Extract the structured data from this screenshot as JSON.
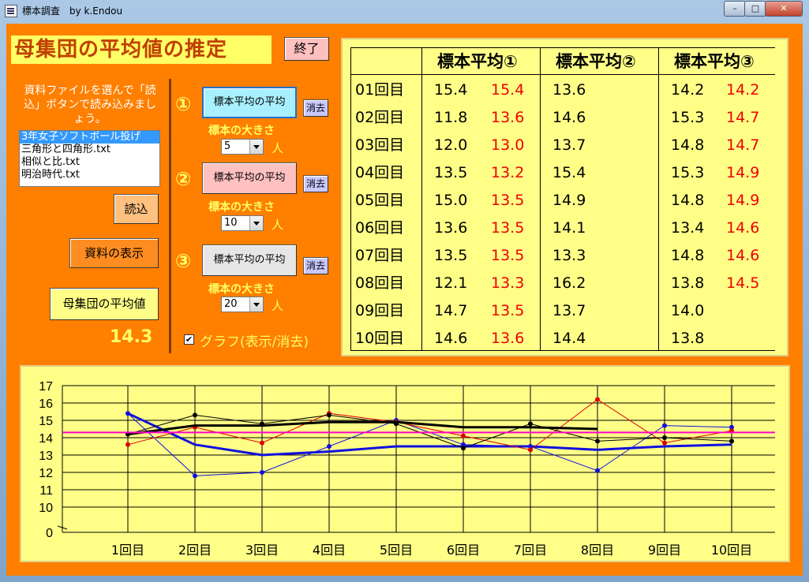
{
  "window": {
    "title": "標本調査　by k.Endou",
    "min": "–",
    "max": "□",
    "close": "✕"
  },
  "heading": "母集団の平均値の推定",
  "exit_button": "終了",
  "instructions": "資料ファイルを選んで「読込」ボタンで読み込みましょう。",
  "files": [
    "3年女子ソフトボール投げ",
    "三角形と四角形.txt",
    "相似と比.txt",
    "明治時代.txt"
  ],
  "load_button": "読込",
  "show_data_button": "資料の表示",
  "population_mean_button": "母集団の平均値",
  "population_mean_value": "14.3",
  "samplers": [
    {
      "number": "①",
      "button": "標本平均の平均",
      "clear": "消去",
      "size_label": "標本の大きさ",
      "size": "5",
      "unit": "人"
    },
    {
      "number": "②",
      "button": "標本平均の平均",
      "clear": "消去",
      "size_label": "標本の大きさ",
      "size": "10",
      "unit": "人"
    },
    {
      "number": "③",
      "button": "標本平均の平均",
      "clear": "消去",
      "size_label": "標本の大きさ",
      "size": "20",
      "unit": "人"
    }
  ],
  "graph_checkbox": {
    "mark": "✔",
    "label": "グラフ(表示/消去)"
  },
  "table": {
    "headers": [
      "標本平均①",
      "標本平均②",
      "標本平均③"
    ],
    "rows": [
      {
        "label": "01回目",
        "s1": "15.4",
        "r1": "15.4",
        "s2": "13.6",
        "s3": "14.2",
        "r3": "14.2"
      },
      {
        "label": "02回目",
        "s1": "11.8",
        "r1": "13.6",
        "s2": "14.6",
        "s3": "15.3",
        "r3": "14.7"
      },
      {
        "label": "03回目",
        "s1": "12.0",
        "r1": "13.0",
        "s2": "13.7",
        "s3": "14.8",
        "r3": "14.7"
      },
      {
        "label": "04回目",
        "s1": "13.5",
        "r1": "13.2",
        "s2": "15.4",
        "s3": "15.3",
        "r3": "14.9"
      },
      {
        "label": "05回目",
        "s1": "15.0",
        "r1": "13.5",
        "s2": "14.9",
        "s3": "14.8",
        "r3": "14.9"
      },
      {
        "label": "06回目",
        "s1": "13.6",
        "r1": "13.5",
        "s2": "14.1",
        "s3": "13.4",
        "r3": "14.6"
      },
      {
        "label": "07回目",
        "s1": "13.5",
        "r1": "13.5",
        "s2": "13.3",
        "s3": "14.8",
        "r3": "14.6"
      },
      {
        "label": "08回目",
        "s1": "12.1",
        "r1": "13.3",
        "s2": "16.2",
        "s3": "13.8",
        "r3": "14.5"
      },
      {
        "label": "09回目",
        "s1": "14.7",
        "r1": "13.5",
        "s2": "13.7",
        "s3": "14.0",
        "r3": ""
      },
      {
        "label": "10回目",
        "s1": "14.6",
        "r1": "13.6",
        "s2": "14.4",
        "s3": "13.8",
        "r3": ""
      }
    ]
  },
  "chart_data": {
    "type": "line",
    "categories": [
      "1回目",
      "2回目",
      "3回目",
      "4回目",
      "5回目",
      "6回目",
      "7回目",
      "8回目",
      "9回目",
      "10回目"
    ],
    "y_ticks": [
      "0",
      "10",
      "11",
      "12",
      "13",
      "14",
      "15",
      "16",
      "17"
    ],
    "ylim": [
      10,
      17
    ],
    "grid": true,
    "population_mean": 14.3,
    "series": [
      {
        "key": "sample1",
        "color": "#1010e0",
        "width": 1,
        "values": [
          15.4,
          11.8,
          12.0,
          13.5,
          15.0,
          13.6,
          13.5,
          12.1,
          14.7,
          14.6
        ]
      },
      {
        "key": "sample1_mean",
        "color": "#1010e0",
        "width": 3,
        "values": [
          15.4,
          13.6,
          13.0,
          13.2,
          13.5,
          13.5,
          13.5,
          13.3,
          13.5,
          13.6
        ]
      },
      {
        "key": "sample2",
        "color": "#e00000",
        "width": 1,
        "values": [
          13.6,
          14.6,
          13.7,
          15.4,
          14.9,
          14.1,
          13.3,
          16.2,
          13.7,
          14.4
        ]
      },
      {
        "key": "sample3",
        "color": "#000000",
        "width": 1,
        "values": [
          14.2,
          15.3,
          14.8,
          15.3,
          14.8,
          13.4,
          14.8,
          13.8,
          14.0,
          13.8
        ]
      },
      {
        "key": "sample3_mean",
        "color": "#000000",
        "width": 3,
        "values": [
          14.2,
          14.7,
          14.7,
          14.9,
          14.9,
          14.6,
          14.6,
          14.5
        ]
      }
    ],
    "mean_line_color": "#ff00cc"
  }
}
